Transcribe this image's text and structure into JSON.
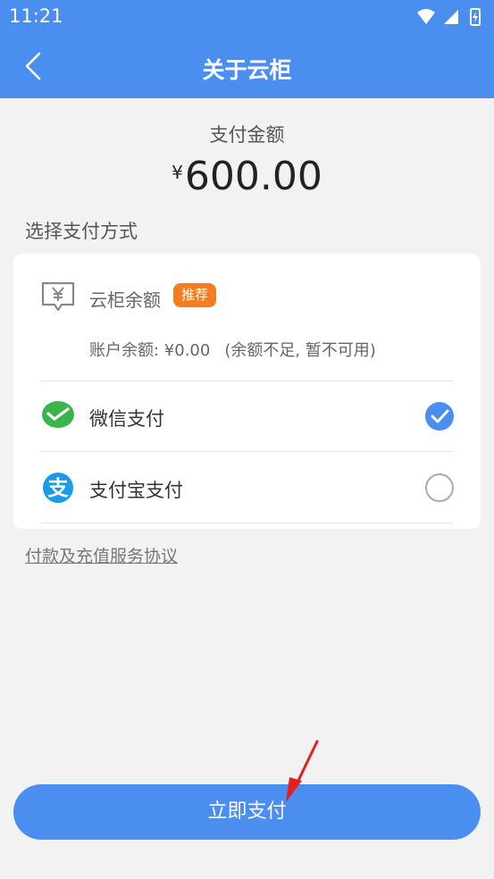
{
  "status_bar": {
    "time": "11:21"
  },
  "app_bar": {
    "title": "关于云柜"
  },
  "payment": {
    "amount_label": "支付金额",
    "currency_symbol": "¥",
    "amount": "600.00"
  },
  "methods_label": "选择支付方式",
  "balance": {
    "name": "云柜余额",
    "badge": "推荐",
    "detail": "账户余额: ¥0.00",
    "note": "(余额不足, 暂不可用)"
  },
  "options": [
    {
      "label": "微信支付",
      "selected": true,
      "icon": "wechat-pay-icon"
    },
    {
      "label": "支付宝支付",
      "selected": false,
      "icon": "alipay-icon"
    }
  ],
  "agreement_link": "付款及充值服务协议",
  "pay_button": "立即支付",
  "colors": {
    "primary": "#4a8ef0",
    "badge": "#f57c1f",
    "wechat": "#3ab54a",
    "alipay": "#1a9be8",
    "arrow": "#e81e1e"
  }
}
